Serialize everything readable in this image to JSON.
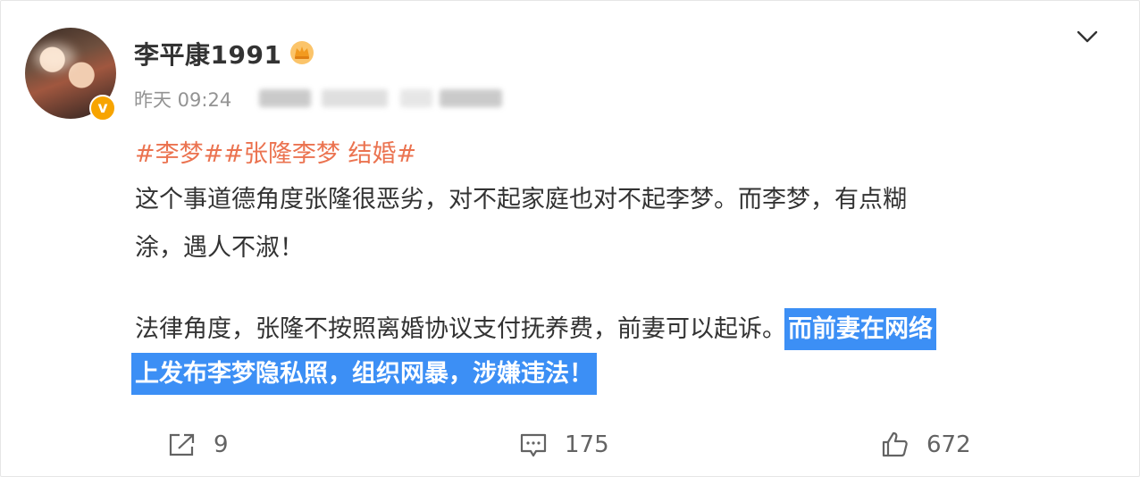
{
  "post": {
    "username": "李平康1991",
    "time": "昨天 09:24",
    "hashtags": "#李梦##张隆李梦 结婚#",
    "line1": "这个事道德角度张隆很恶劣，对不起家庭也对不起李梦。而李梦，有点糊",
    "line2": "涂，遇人不淑！",
    "line3_plain": "法律角度，张隆不按照离婚协议支付抚养费，前妻可以起诉。",
    "line3_highlight": "而前妻在网络",
    "line4_highlight": "上发布李梦隐私照，组织网暴，涉嫌违法！"
  },
  "actions": {
    "repost_count": "9",
    "comment_count": "175",
    "like_count": "672"
  },
  "icons": {
    "verified": "verified-badge-icon",
    "vip": "vip-crown-icon",
    "menu": "chevron-down-icon",
    "repost": "share-icon",
    "comment": "comment-icon",
    "like": "thumbs-up-icon"
  },
  "colors": {
    "hashtag": "#eb7350",
    "highlight": "#3c8ff5",
    "verified": "#f7a400",
    "muted": "#939393"
  }
}
